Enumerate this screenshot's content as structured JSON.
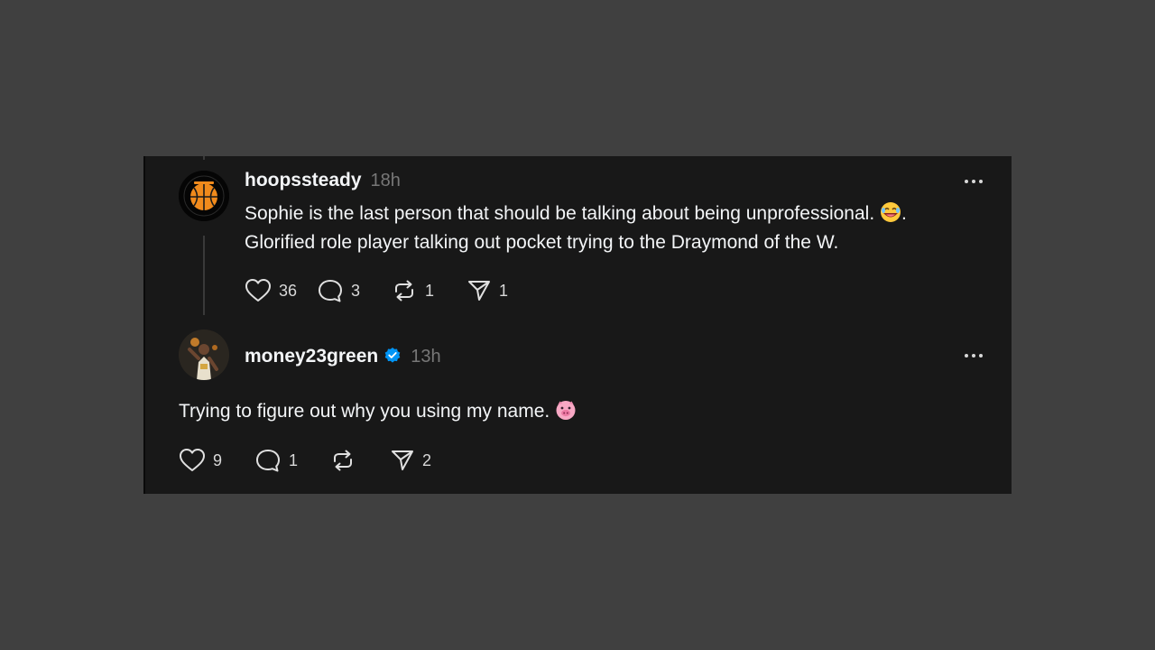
{
  "colors": {
    "background": "#404040",
    "card": "#181818",
    "text": "#f3f5f7",
    "muted": "#777777",
    "verified": "#0095f6"
  },
  "posts": [
    {
      "username": "hoopssteady",
      "time": "18h",
      "avatar_icon": "basketball-logo-avatar",
      "text_line1": "Sophie is the last person that should be talking about being unprofessional.",
      "text_line1_end": ".",
      "text_line2": "Glorified role player talking out pocket trying to the Draymond of the W.",
      "emoji_icon": "laughing-face-emoji",
      "actions": {
        "likes": "36",
        "replies": "3",
        "reposts": "1",
        "shares": "1"
      }
    },
    {
      "username": "money23green",
      "time": "13h",
      "verified": true,
      "avatar_icon": "player-photo-avatar",
      "text": "Trying to figure out why you using my name.",
      "emoji_icon": "pig-face-emoji",
      "actions": {
        "likes": "9",
        "replies": "1",
        "reposts": "",
        "shares": "2"
      }
    }
  ]
}
